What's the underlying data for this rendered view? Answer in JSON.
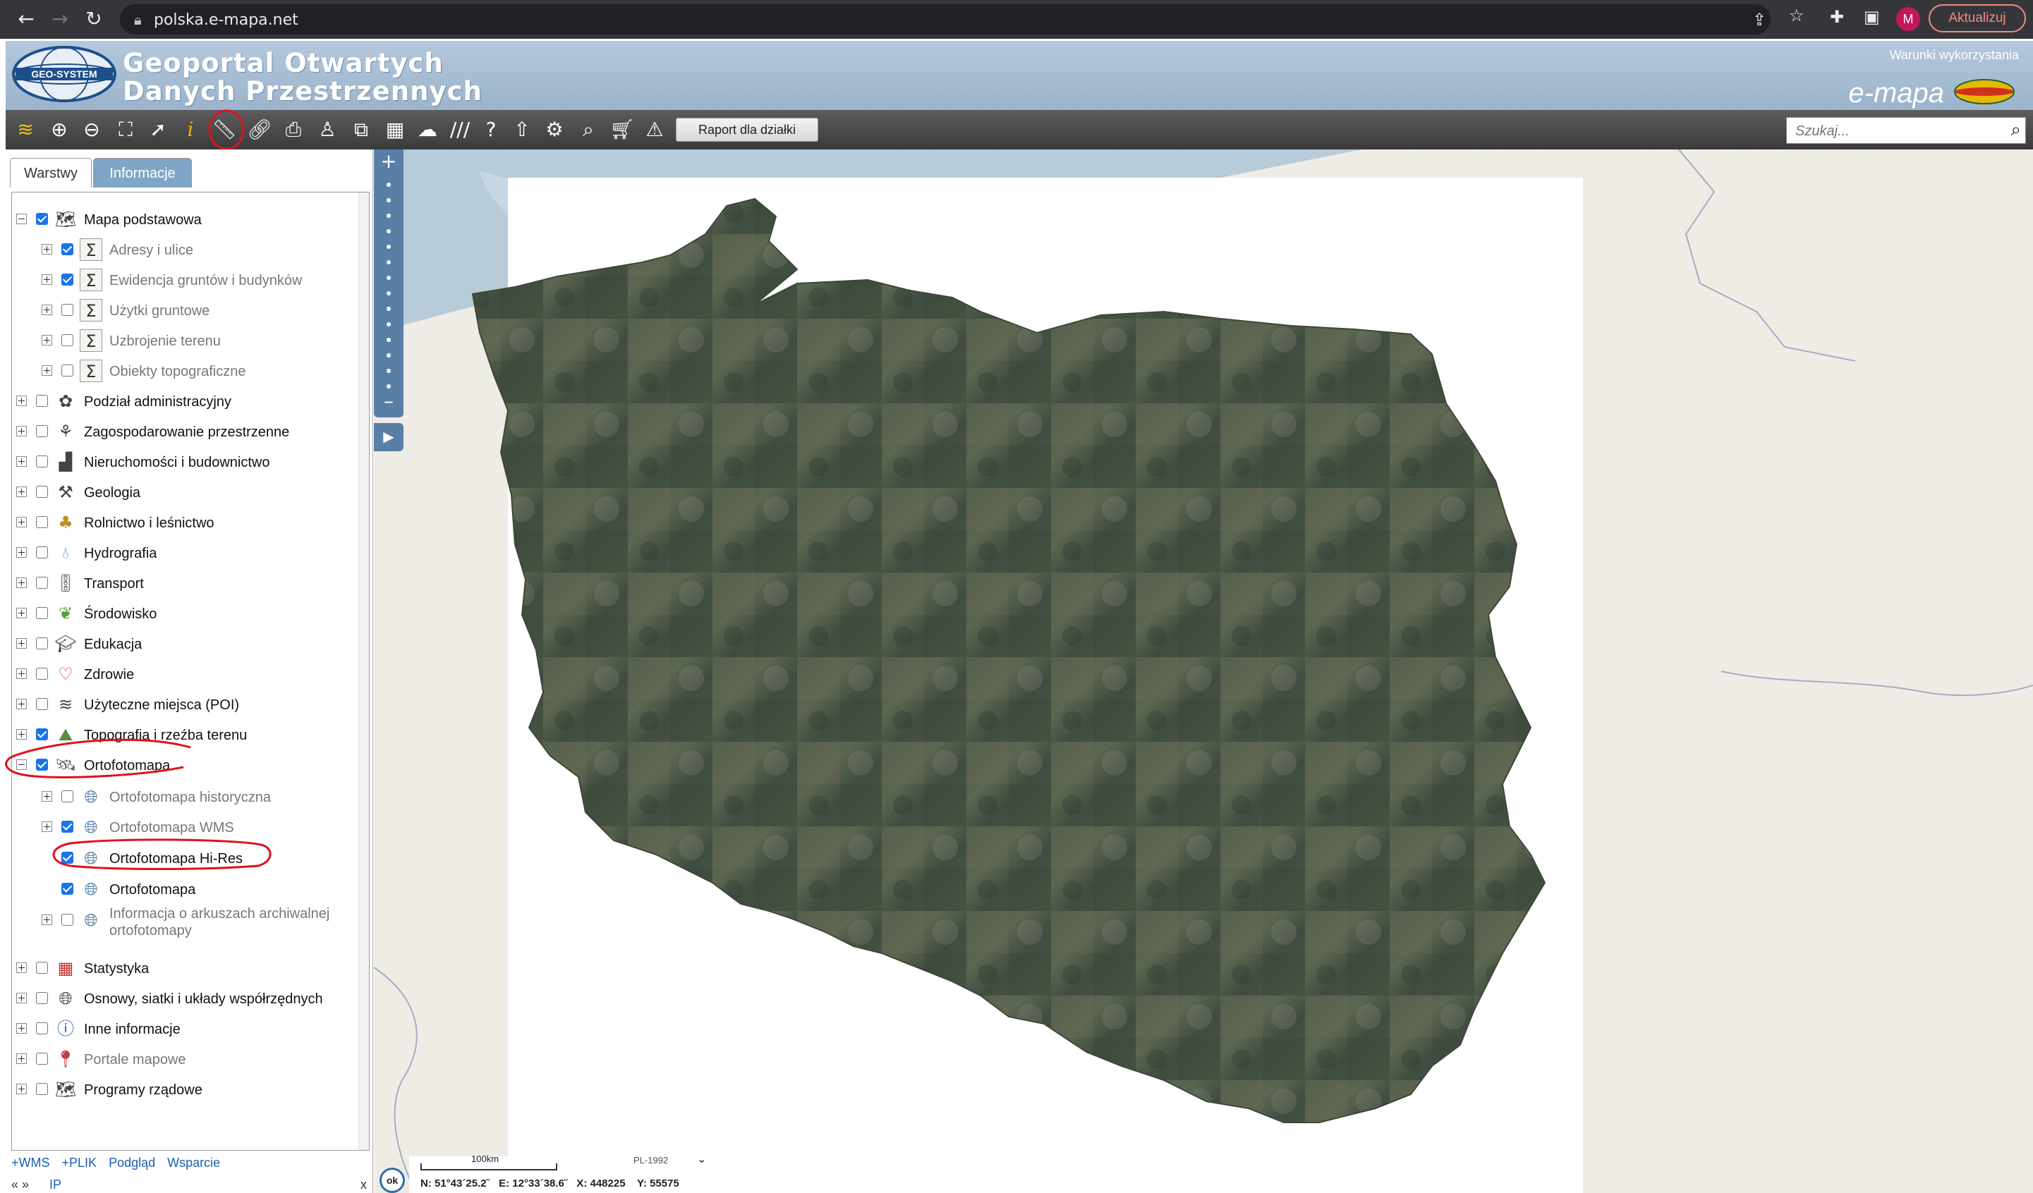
{
  "browser": {
    "url": "polska.e-mapa.net",
    "profile_initial": "M",
    "update_label": "Aktualizuj"
  },
  "header": {
    "title_line1": "Geoportal Otwartych",
    "title_line2": "Danych Przestrzennych",
    "logo_text": "GEO-SYSTEM",
    "terms_link": "Warunki wykorzystania",
    "brand": "e-mapa"
  },
  "toolbar": {
    "report_button": "Raport dla działki",
    "search_placeholder": "Szukaj..."
  },
  "sidebar": {
    "tabs": [
      {
        "label": "Warstwy",
        "active": true
      },
      {
        "label": "Informacje",
        "active": false
      }
    ],
    "layers": [
      {
        "label": "Mapa podstawowa",
        "checked": true,
        "expanded": true,
        "level": 0,
        "icon": "map-base-icon"
      },
      {
        "label": "Adresy i ulice",
        "checked": true,
        "level": 1,
        "grey": true,
        "icon": "sigma-icon"
      },
      {
        "label": "Ewidencja gruntów i budynków",
        "checked": true,
        "level": 1,
        "grey": true,
        "icon": "sigma-icon"
      },
      {
        "label": "Użytki gruntowe",
        "checked": false,
        "level": 1,
        "grey": true,
        "icon": "sigma-icon"
      },
      {
        "label": "Uzbrojenie terenu",
        "checked": false,
        "level": 1,
        "grey": true,
        "icon": "sigma-icon"
      },
      {
        "label": "Obiekty topograficzne",
        "checked": false,
        "level": 1,
        "grey": true,
        "icon": "sigma-icon"
      },
      {
        "label": "Podział administracyjny",
        "checked": false,
        "level": 0,
        "icon": "admin-division-icon"
      },
      {
        "label": "Zagospodarowanie przestrzenne",
        "checked": false,
        "level": 0,
        "icon": "spatial-planning-icon"
      },
      {
        "label": "Nieruchomości i budownictwo",
        "checked": false,
        "level": 0,
        "icon": "buildings-icon"
      },
      {
        "label": "Geologia",
        "checked": false,
        "level": 0,
        "icon": "pickaxe-icon"
      },
      {
        "label": "Rolnictwo i leśnictwo",
        "checked": false,
        "level": 0,
        "icon": "trees-icon"
      },
      {
        "label": "Hydrografia",
        "checked": false,
        "level": 0,
        "icon": "water-drop-icon"
      },
      {
        "label": "Transport",
        "checked": false,
        "level": 0,
        "icon": "traffic-light-icon"
      },
      {
        "label": "Środowisko",
        "checked": false,
        "level": 0,
        "icon": "leaf-icon"
      },
      {
        "label": "Edukacja",
        "checked": false,
        "level": 0,
        "icon": "graduation-cap-icon"
      },
      {
        "label": "Zdrowie",
        "checked": false,
        "level": 0,
        "icon": "heart-icon"
      },
      {
        "label": "Użyteczne miejsca (POI)",
        "checked": false,
        "level": 0,
        "icon": "poi-layers-icon"
      },
      {
        "label": "Topografia i rzeźba terenu",
        "checked": true,
        "level": 0,
        "icon": "topography-icon"
      },
      {
        "label": "Ortofotomapa",
        "checked": true,
        "expanded": true,
        "level": 0,
        "icon": "satellite-icon"
      },
      {
        "label": "Ortofotomapa historyczna",
        "checked": false,
        "level": 1,
        "grey": true,
        "icon": "globe-layer-icon"
      },
      {
        "label": "Ortofotomapa WMS",
        "checked": true,
        "level": 1,
        "grey": true,
        "icon": "globe-layer-icon"
      },
      {
        "label": "Ortofotomapa Hi-Res",
        "checked": true,
        "level": 1,
        "noexp": true,
        "icon": "globe-layer-icon"
      },
      {
        "label": "Ortofotomapa",
        "checked": true,
        "level": 1,
        "noexp": true,
        "icon": "globe-layer-icon"
      },
      {
        "label": "Informacja o arkuszach archiwalnej",
        "label2": "ortofotomapy",
        "checked": false,
        "level": 1,
        "grey": true,
        "icon": "globe-layer-icon"
      },
      {
        "label": "Statystyka",
        "checked": false,
        "level": 0,
        "icon": "statistics-icon"
      },
      {
        "label": "Osnowy, siatki i układy współrzędnych",
        "checked": false,
        "level": 0,
        "icon": "grid-globe-icon"
      },
      {
        "label": "Inne informacje",
        "checked": false,
        "level": 0,
        "icon": "info-icon"
      },
      {
        "label": "Portale mapowe",
        "checked": false,
        "level": 0,
        "grey": true,
        "icon": "map-portal-icon"
      },
      {
        "label": "Programy rządowe",
        "checked": false,
        "level": 0,
        "icon": "government-map-icon"
      }
    ],
    "footer_links": [
      "+WMS",
      "+PLIK",
      "Podgląd",
      "Wsparcie"
    ],
    "footer_row2": {
      "left": "« »",
      "ip": "IP",
      "close": "x"
    }
  },
  "map": {
    "scale_label": "100km",
    "crs": "PL-1992",
    "coords": {
      "n": "N: 51°43´25.2˝",
      "e": "E: 12°33´38.6˝",
      "x": "X: 448225",
      "y": "Y: 55575"
    },
    "ok_label": "ok"
  },
  "colors": {
    "header_bg": "#a8bdd3",
    "toolbar_bg": "#4a4a4a",
    "tab_active_bg": "#7fa6c6",
    "checkbox_on": "#1a73e8",
    "annotation_red": "#e0101e",
    "map_land": "#efece6",
    "map_water": "#b7cbd8"
  }
}
